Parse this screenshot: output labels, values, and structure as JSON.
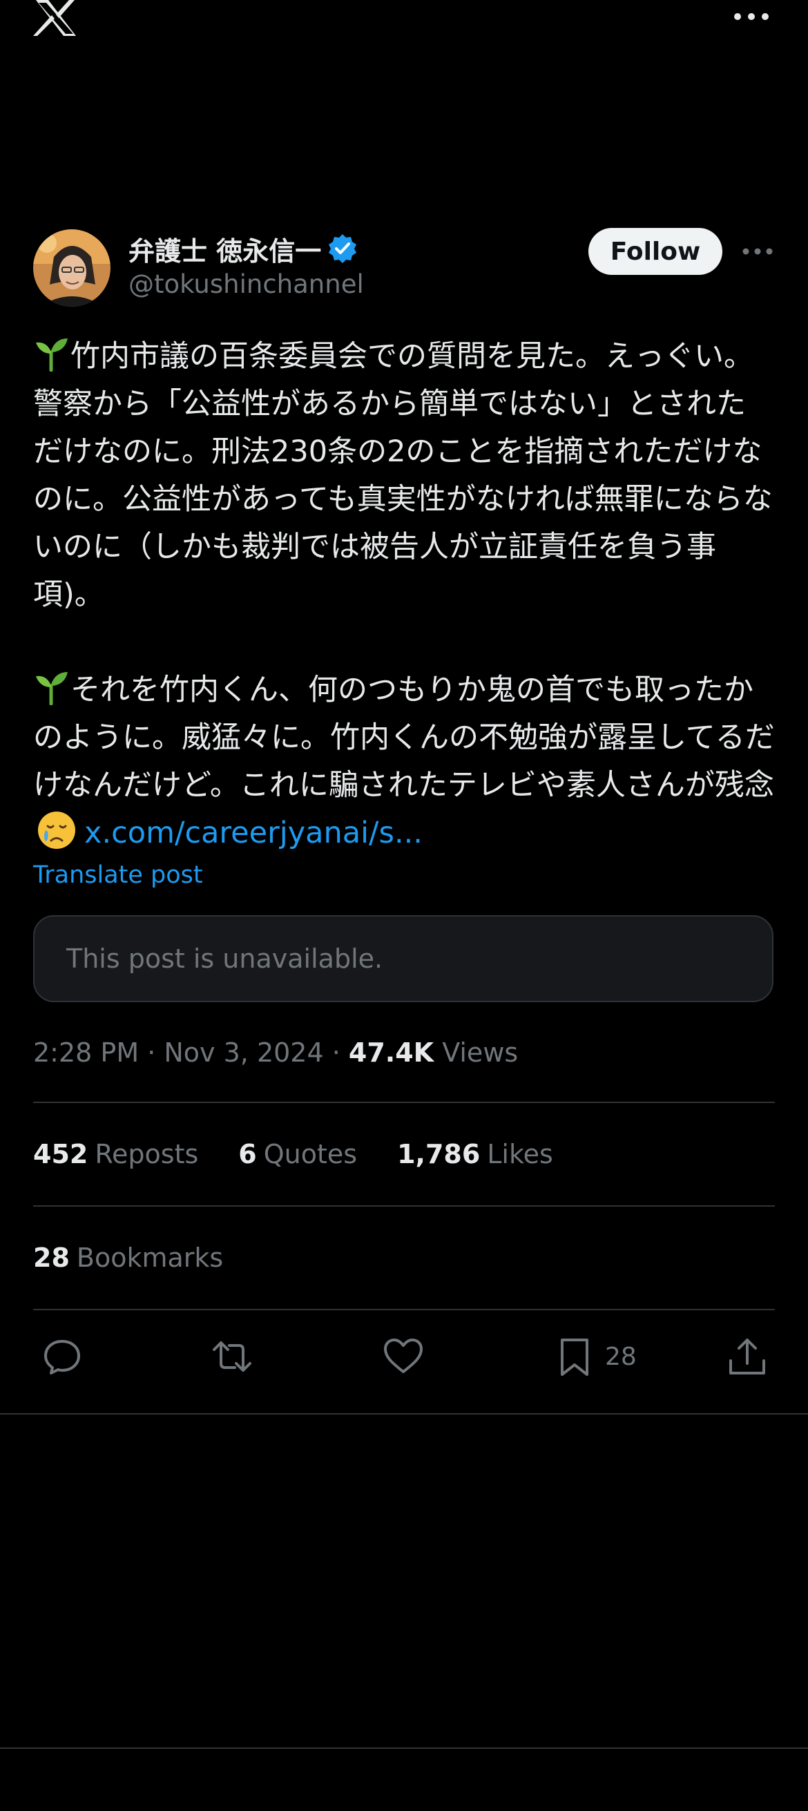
{
  "header": {
    "logo_icon": "x-logo-icon",
    "more_icon": "more-horizontal-icon"
  },
  "author": {
    "display_name": "弁護士 徳永信一",
    "handle": "@tokushinchannel",
    "verified_icon": "verified-badge-icon",
    "follow_label": "Follow"
  },
  "post": {
    "paragraph1": "竹内市議の百条委員会での質問を見た。えっぐい。警察から「公益性があるから簡単ではない」とされただけなのに。刑法230条の2のことを指摘されただけなのに。公益性があっても真実性がなければ無罪にならないのに（しかも裁判では被告人が立証責任を負う事項)。",
    "paragraph2": "それを竹内くん、何のつもりか鬼の首でも取ったかのように。威猛々に。竹内くんの不勉強が露呈してるだけなんだけど。これに騙されたテレビや素人さんが残念",
    "link_text": "x.com/careerjyanai/s...",
    "translate_label": "Translate post",
    "unavailable_text": "This post is unavailable.",
    "emoji_icons": [
      "seedling-emoji-icon",
      "crying-face-emoji-icon"
    ]
  },
  "meta": {
    "time": "2:28 PM",
    "date": "Nov 3, 2024",
    "views_count": "47.4K",
    "views_label": "Views"
  },
  "stats": {
    "reposts_count": "452",
    "reposts_label": "Reposts",
    "quotes_count": "6",
    "quotes_label": "Quotes",
    "likes_count": "1,786",
    "likes_label": "Likes",
    "bookmarks_count": "28",
    "bookmarks_label": "Bookmarks"
  },
  "actions": {
    "reply_icon": "reply-icon",
    "repost_icon": "repost-icon",
    "like_icon": "heart-icon",
    "bookmark_icon": "bookmark-icon",
    "bookmark_count": "28",
    "share_icon": "share-icon"
  },
  "colors": {
    "background": "#000000",
    "text_primary": "#e7e9ea",
    "text_secondary": "#71767b",
    "link": "#1d9bf0",
    "divider": "#2f3336",
    "follow_bg": "#eff3f4",
    "card_bg": "#16181c",
    "verified": "#1d9bf0"
  }
}
